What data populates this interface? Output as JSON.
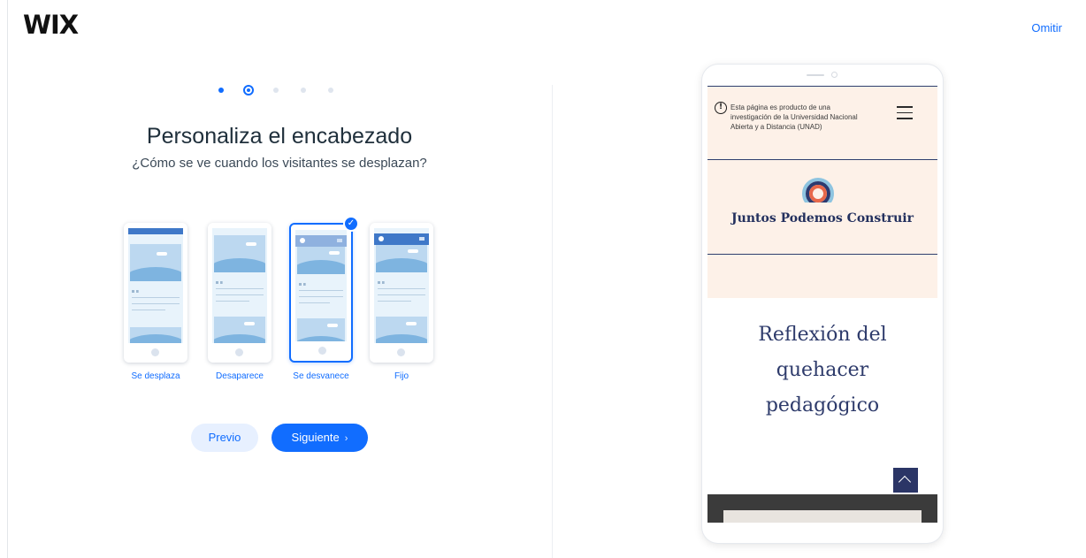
{
  "header": {
    "logo": "WIX",
    "skip_label": "Omitir"
  },
  "accent_color": "#116dff",
  "wizard": {
    "step_total": 5,
    "step_current": 2,
    "title": "Personaliza el encabezado",
    "subtitle": "¿Cómo se ve cuando los visitantes se desplazan?",
    "options": [
      {
        "label": "Se desplaza",
        "selected": false
      },
      {
        "label": "Desaparece",
        "selected": false
      },
      {
        "label": "Se desvanece",
        "selected": true
      },
      {
        "label": "Fijo",
        "selected": false
      }
    ],
    "check_icon": "check-icon",
    "prev_label": "Previo",
    "next_label": "Siguiente",
    "next_icon": "chevron-right-icon"
  },
  "preview": {
    "notice": "Esta página es producto de una investigación de la Universidad Nacional Abierta y a Distancia (UNAD)",
    "notice_icon": "info-icon",
    "menu_icon": "hamburger-menu-icon",
    "site_name": "Juntos Podemos Construir",
    "hero_lines": [
      "Reflexión del",
      "quehacer",
      "pedagógico"
    ],
    "back_to_top_icon": "chevron-up-icon"
  }
}
